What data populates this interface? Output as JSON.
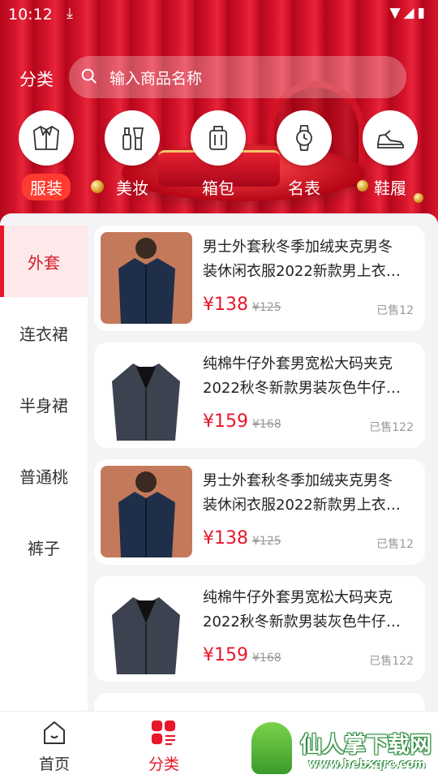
{
  "status_bar": {
    "time": "10:12"
  },
  "header": {
    "title": "分类",
    "search_placeholder": "输入商品名称"
  },
  "categories": [
    {
      "label": "服装",
      "icon": "jacket-icon",
      "active": true
    },
    {
      "label": "美妆",
      "icon": "makeup-icon",
      "active": false
    },
    {
      "label": "箱包",
      "icon": "luggage-icon",
      "active": false
    },
    {
      "label": "名表",
      "icon": "watch-icon",
      "active": false
    },
    {
      "label": "鞋履",
      "icon": "sneaker-icon",
      "active": false
    }
  ],
  "sidebar": {
    "items": [
      {
        "label": "外套",
        "active": true
      },
      {
        "label": "连衣裙",
        "active": false
      },
      {
        "label": "半身裙",
        "active": false
      },
      {
        "label": "普通桃",
        "active": false
      },
      {
        "label": "裤子",
        "active": false
      }
    ]
  },
  "products": [
    {
      "title_line1": "男士外套秋冬季加绒夹克男冬",
      "title_line2": "装休闲衣服2022新款男上衣中…",
      "price": "¥138",
      "original_price": "¥125",
      "sold": "已售12",
      "image": "navy-jacket"
    },
    {
      "title_line1": " 纯棉牛仔外套男宽松大码夹克",
      "title_line2": "2022秋冬新款男装灰色牛仔衣…",
      "price": "¥159",
      "original_price": "¥168",
      "sold": "已售122",
      "image": "denim-jacket"
    },
    {
      "title_line1": "男士外套秋冬季加绒夹克男冬",
      "title_line2": "装休闲衣服2022新款男上衣中…",
      "price": "¥138",
      "original_price": "¥125",
      "sold": "已售12",
      "image": "navy-jacket"
    },
    {
      "title_line1": " 纯棉牛仔外套男宽松大码夹克",
      "title_line2": "2022秋冬新款男装灰色牛仔衣…",
      "price": "¥159",
      "original_price": "¥168",
      "sold": "已售122",
      "image": "denim-jacket"
    }
  ],
  "tabbar": {
    "items": [
      {
        "label": "首页",
        "icon": "home-icon",
        "active": false
      },
      {
        "label": "分类",
        "icon": "category-icon",
        "active": true
      }
    ]
  },
  "watermark": {
    "name": "仙人掌下载网",
    "url": "www.hebxqrc.com"
  },
  "colors": {
    "accent": "#e8172b",
    "hero": "#c90d20",
    "active_bg": "#fde8ea"
  }
}
